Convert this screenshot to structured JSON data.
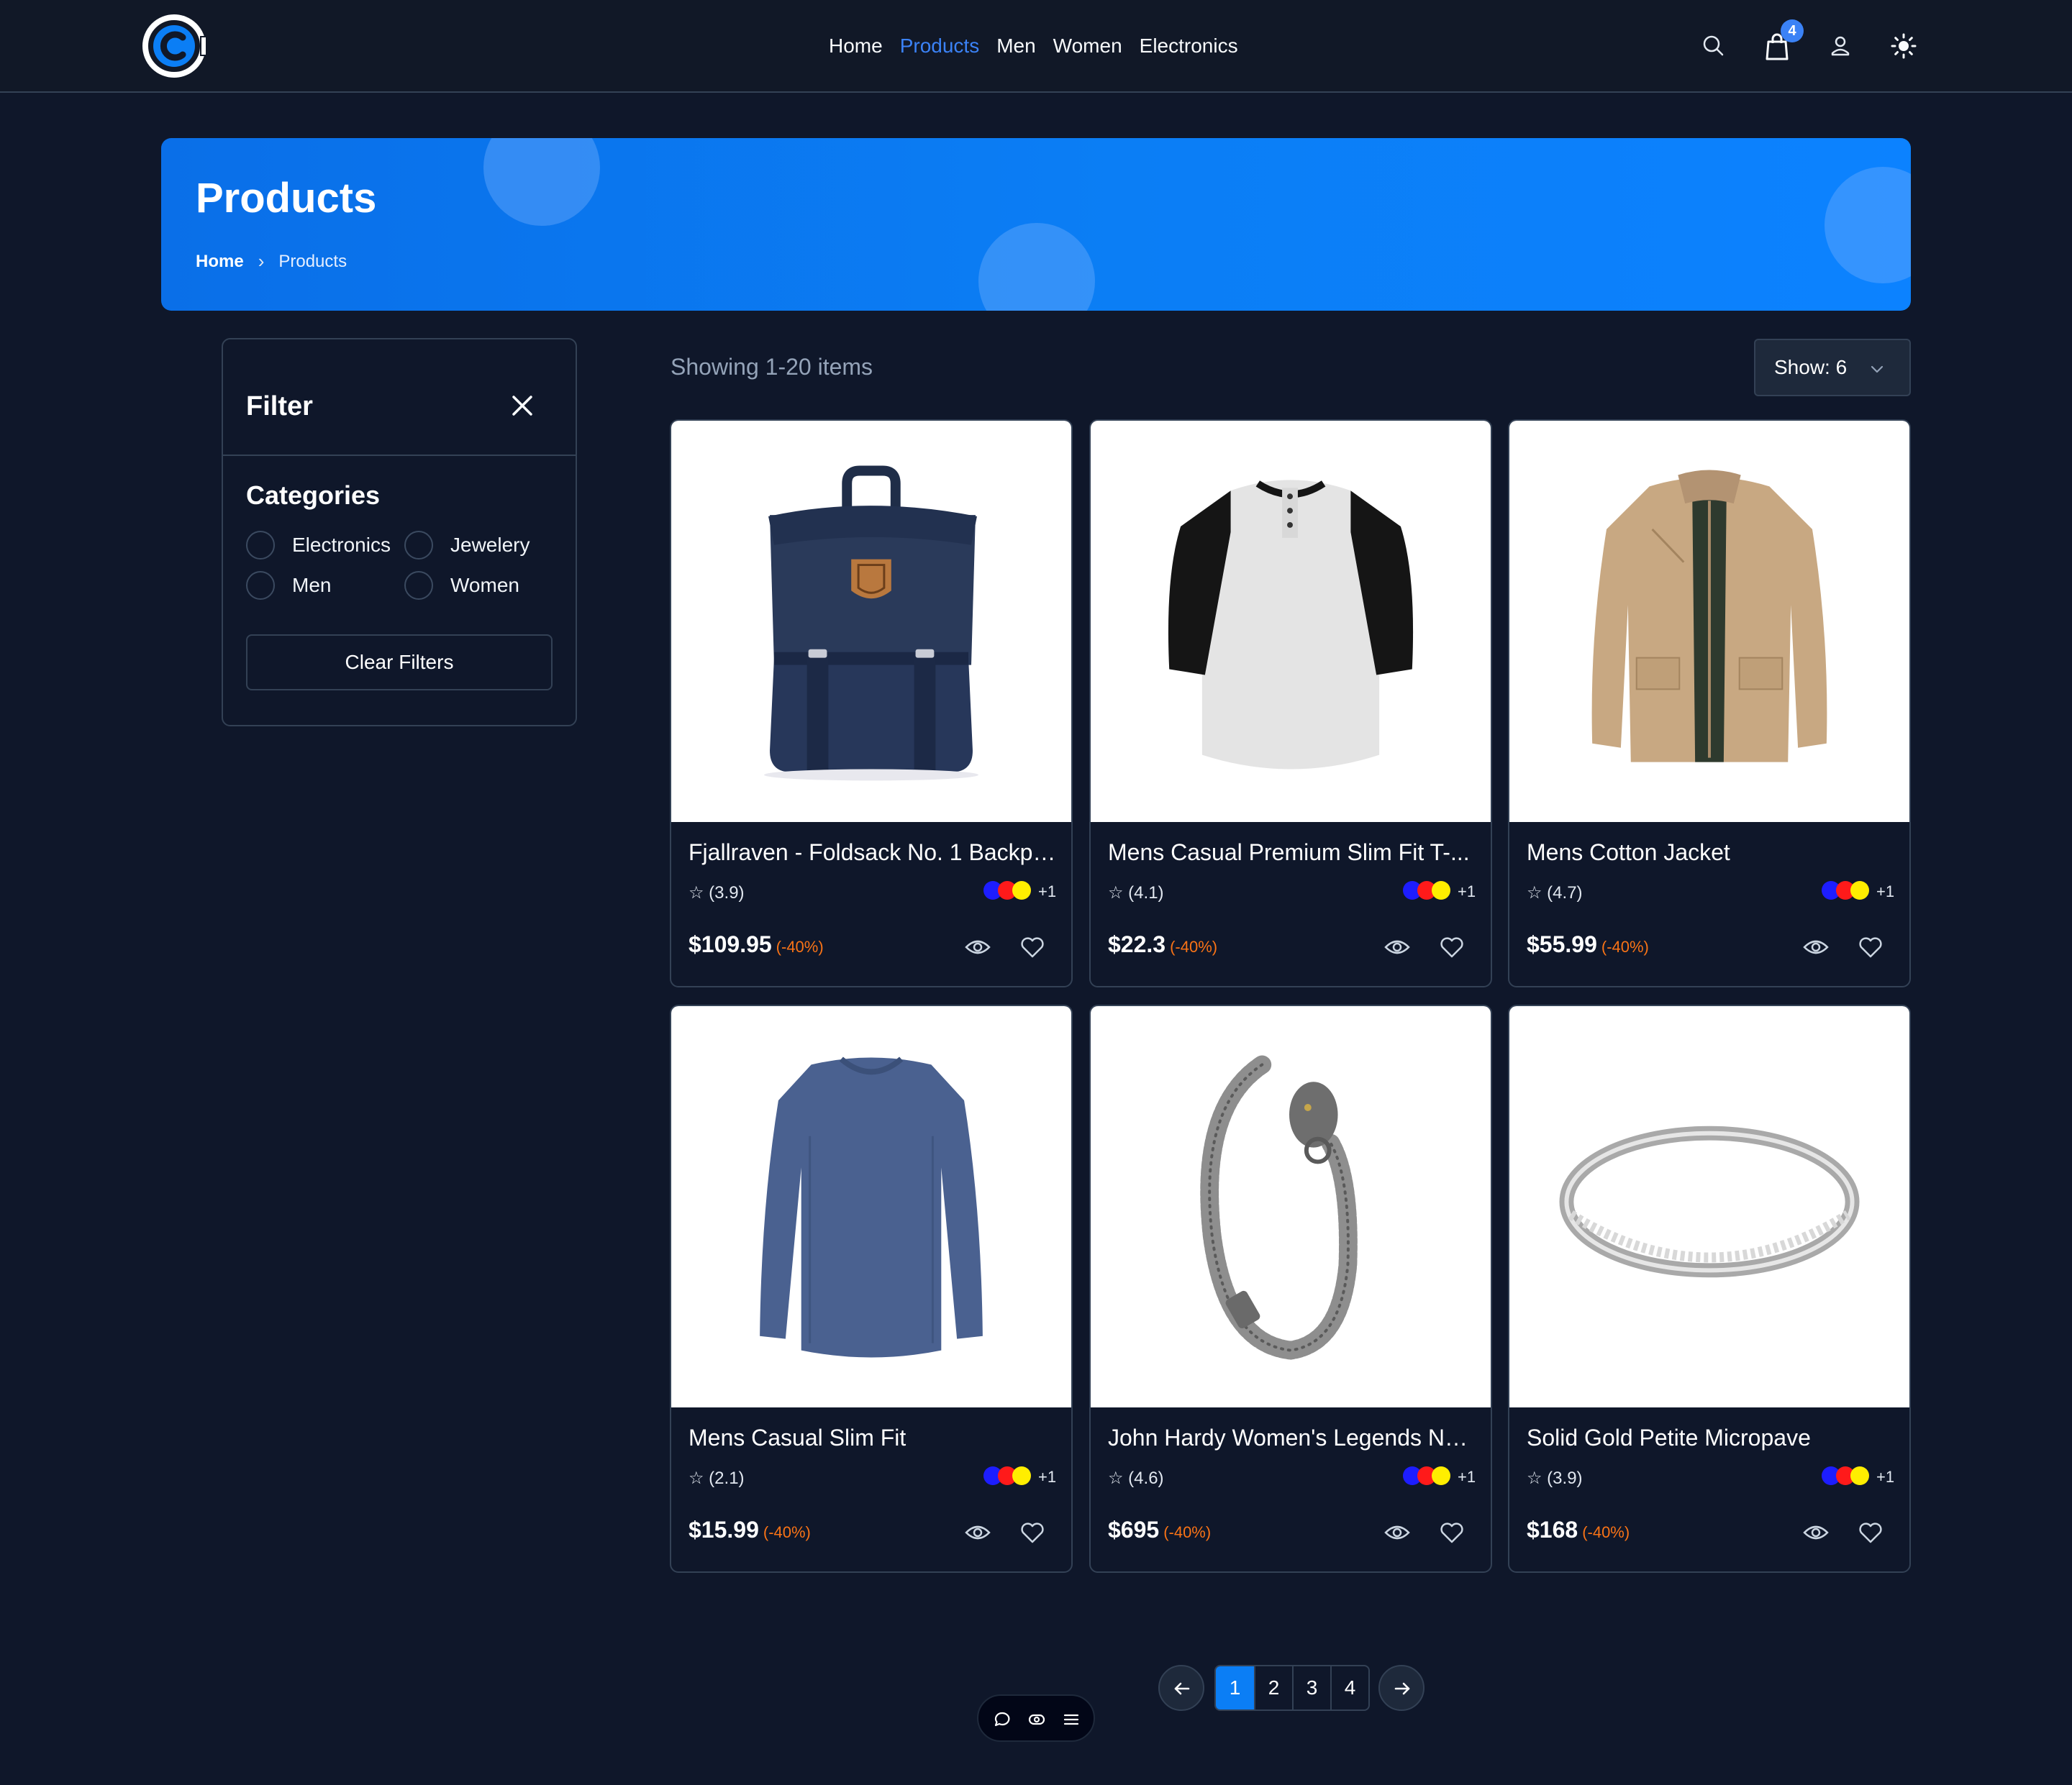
{
  "nav": {
    "links": [
      "Home",
      "Products",
      "Men",
      "Women",
      "Electronics"
    ],
    "active": "Products",
    "cart_count": "4",
    "icons": [
      "logo-icon",
      "search-icon",
      "cart-icon",
      "user-icon",
      "sun-icon"
    ],
    "accent_color": "#3b82f6"
  },
  "hero": {
    "title": "Products",
    "breadcrumb": {
      "home": "Home",
      "current": "Products"
    }
  },
  "filter": {
    "title": "Filter",
    "categories_title": "Categories",
    "categories": [
      "Electronics",
      "Jewelery",
      "Men",
      "Women"
    ],
    "clear_label": "Clear Filters"
  },
  "toolbar": {
    "showing_text": "Showing 1-20 items",
    "show_label": "Show: 6"
  },
  "products": [
    {
      "title": "Fjallraven - Foldsack No. 1 Backpa...",
      "rating": "☆ (3.9)",
      "price": "$109.95",
      "discount": "(-40%)",
      "extra_colors": "+1",
      "image": "backpack"
    },
    {
      "title": "Mens Casual Premium Slim Fit T-...",
      "rating": "☆ (4.1)",
      "price": "$22.3",
      "discount": "(-40%)",
      "extra_colors": "+1",
      "image": "raglan-tshirt"
    },
    {
      "title": "Mens Cotton Jacket",
      "rating": "☆ (4.7)",
      "price": "$55.99",
      "discount": "(-40%)",
      "extra_colors": "+1",
      "image": "jacket"
    },
    {
      "title": "Mens Casual Slim Fit",
      "rating": "☆ (2.1)",
      "price": "$15.99",
      "discount": "(-40%)",
      "extra_colors": "+1",
      "image": "long-sleeve-shirt"
    },
    {
      "title": "John Hardy Women's Legends Na...",
      "rating": "☆ (4.6)",
      "price": "$695",
      "discount": "(-40%)",
      "extra_colors": "+1",
      "image": "bracelet"
    },
    {
      "title": "Solid Gold Petite Micropave",
      "rating": "☆ (3.9)",
      "price": "$168",
      "discount": "(-40%)",
      "extra_colors": "+1",
      "image": "ring"
    }
  ],
  "swatch_colors": [
    "#1d1dff",
    "#ff1a1a",
    "#ffee00"
  ],
  "discount_color": "#f97316",
  "pagination": {
    "pages": [
      "1",
      "2",
      "3",
      "4"
    ],
    "active": "1"
  }
}
